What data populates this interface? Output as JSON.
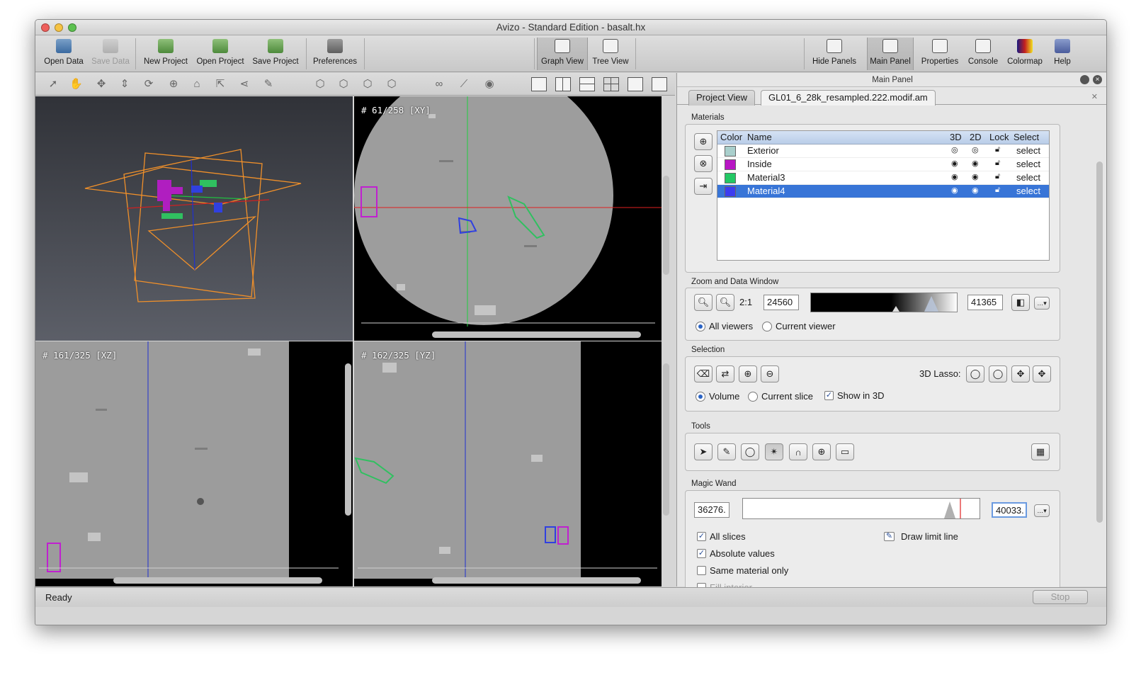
{
  "window": {
    "title": "Avizo - Standard Edition - basalt.hx"
  },
  "toolbar": {
    "open_data": "Open Data",
    "save_data": "Save Data",
    "new_project": "New Project",
    "open_project": "Open Project",
    "save_project": "Save Project",
    "preferences": "Preferences",
    "graph_view": "Graph View",
    "tree_view": "Tree View",
    "hide_panels": "Hide Panels",
    "main_panel": "Main Panel",
    "properties": "Properties",
    "console": "Console",
    "colormap": "Colormap",
    "help": "Help"
  },
  "viewers": {
    "xy": "# 61/258 [XY]",
    "xz": "# 161/325 [XZ]",
    "yz": "# 162/325 [YZ]"
  },
  "panel": {
    "title": "Main Panel",
    "tabs": [
      "Project View",
      "GL01_6_28k_resampled.222.modif.am"
    ],
    "materials": {
      "label": "Materials",
      "headers": {
        "color": "Color",
        "name": "Name",
        "d3": "3D",
        "d2": "2D",
        "lock": "Lock",
        "select": "Select"
      },
      "rows": [
        {
          "name": "Exterior",
          "color": "#a9cfcc",
          "select": "select"
        },
        {
          "name": "Inside",
          "color": "#b816c4",
          "select": "select"
        },
        {
          "name": "Material3",
          "color": "#22c864",
          "select": "select"
        },
        {
          "name": "Material4",
          "color": "#3c3cf0",
          "select": "select"
        }
      ]
    },
    "zoom": {
      "label": "Zoom and Data Window",
      "ratio": "2:1",
      "min": "24560",
      "max": "41365",
      "all_viewers": "All viewers",
      "current_viewer": "Current viewer"
    },
    "selection": {
      "label": "Selection",
      "lasso": "3D Lasso:",
      "volume": "Volume",
      "current_slice": "Current slice",
      "show_3d": "Show in 3D"
    },
    "tools": {
      "label": "Tools"
    },
    "wand": {
      "label": "Magic Wand",
      "low": "36276.",
      "high": "40033.",
      "all_slices": "All slices",
      "absolute": "Absolute values",
      "same_material": "Same material only",
      "fill_interior": "Fill interior",
      "draw_limit": "Draw limit line"
    }
  },
  "status": {
    "text": "Ready",
    "stop": "Stop"
  },
  "colors": {
    "selection": "#3875d7",
    "accent": "#2a63c4"
  }
}
